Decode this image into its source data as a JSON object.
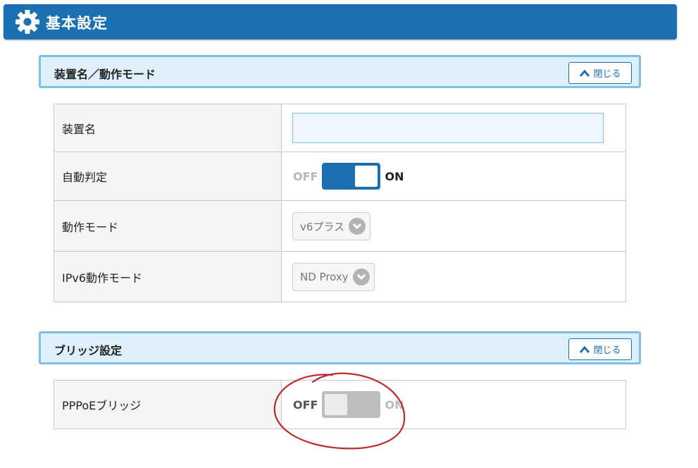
{
  "header": {
    "title": "基本設定",
    "icon": "gear-icon"
  },
  "sections": [
    {
      "title": "装置名／動作モード",
      "close_label": "閉じる",
      "rows": [
        {
          "label": "装置名",
          "type": "text",
          "value": ""
        },
        {
          "label": "自動判定",
          "type": "toggle",
          "off_label": "OFF",
          "on_label": "ON",
          "state": "on"
        },
        {
          "label": "動作モード",
          "type": "select",
          "value": "v6プラス"
        },
        {
          "label": "IPv6動作モード",
          "type": "select",
          "value": "ND Proxy"
        }
      ]
    },
    {
      "title": "ブリッジ設定",
      "close_label": "閉じる",
      "rows": [
        {
          "label": "PPPoEブリッジ",
          "type": "toggle",
          "off_label": "OFF",
          "on_label": "ON",
          "state": "off"
        }
      ]
    }
  ],
  "colors": {
    "header_bg": "#1b6fb3",
    "section_bg": "#dff0fb",
    "section_border": "#7dc0e6",
    "toggle_on": "#1b6fb3",
    "toggle_off": "#bdbdbd",
    "annotation": "#c0282d"
  }
}
